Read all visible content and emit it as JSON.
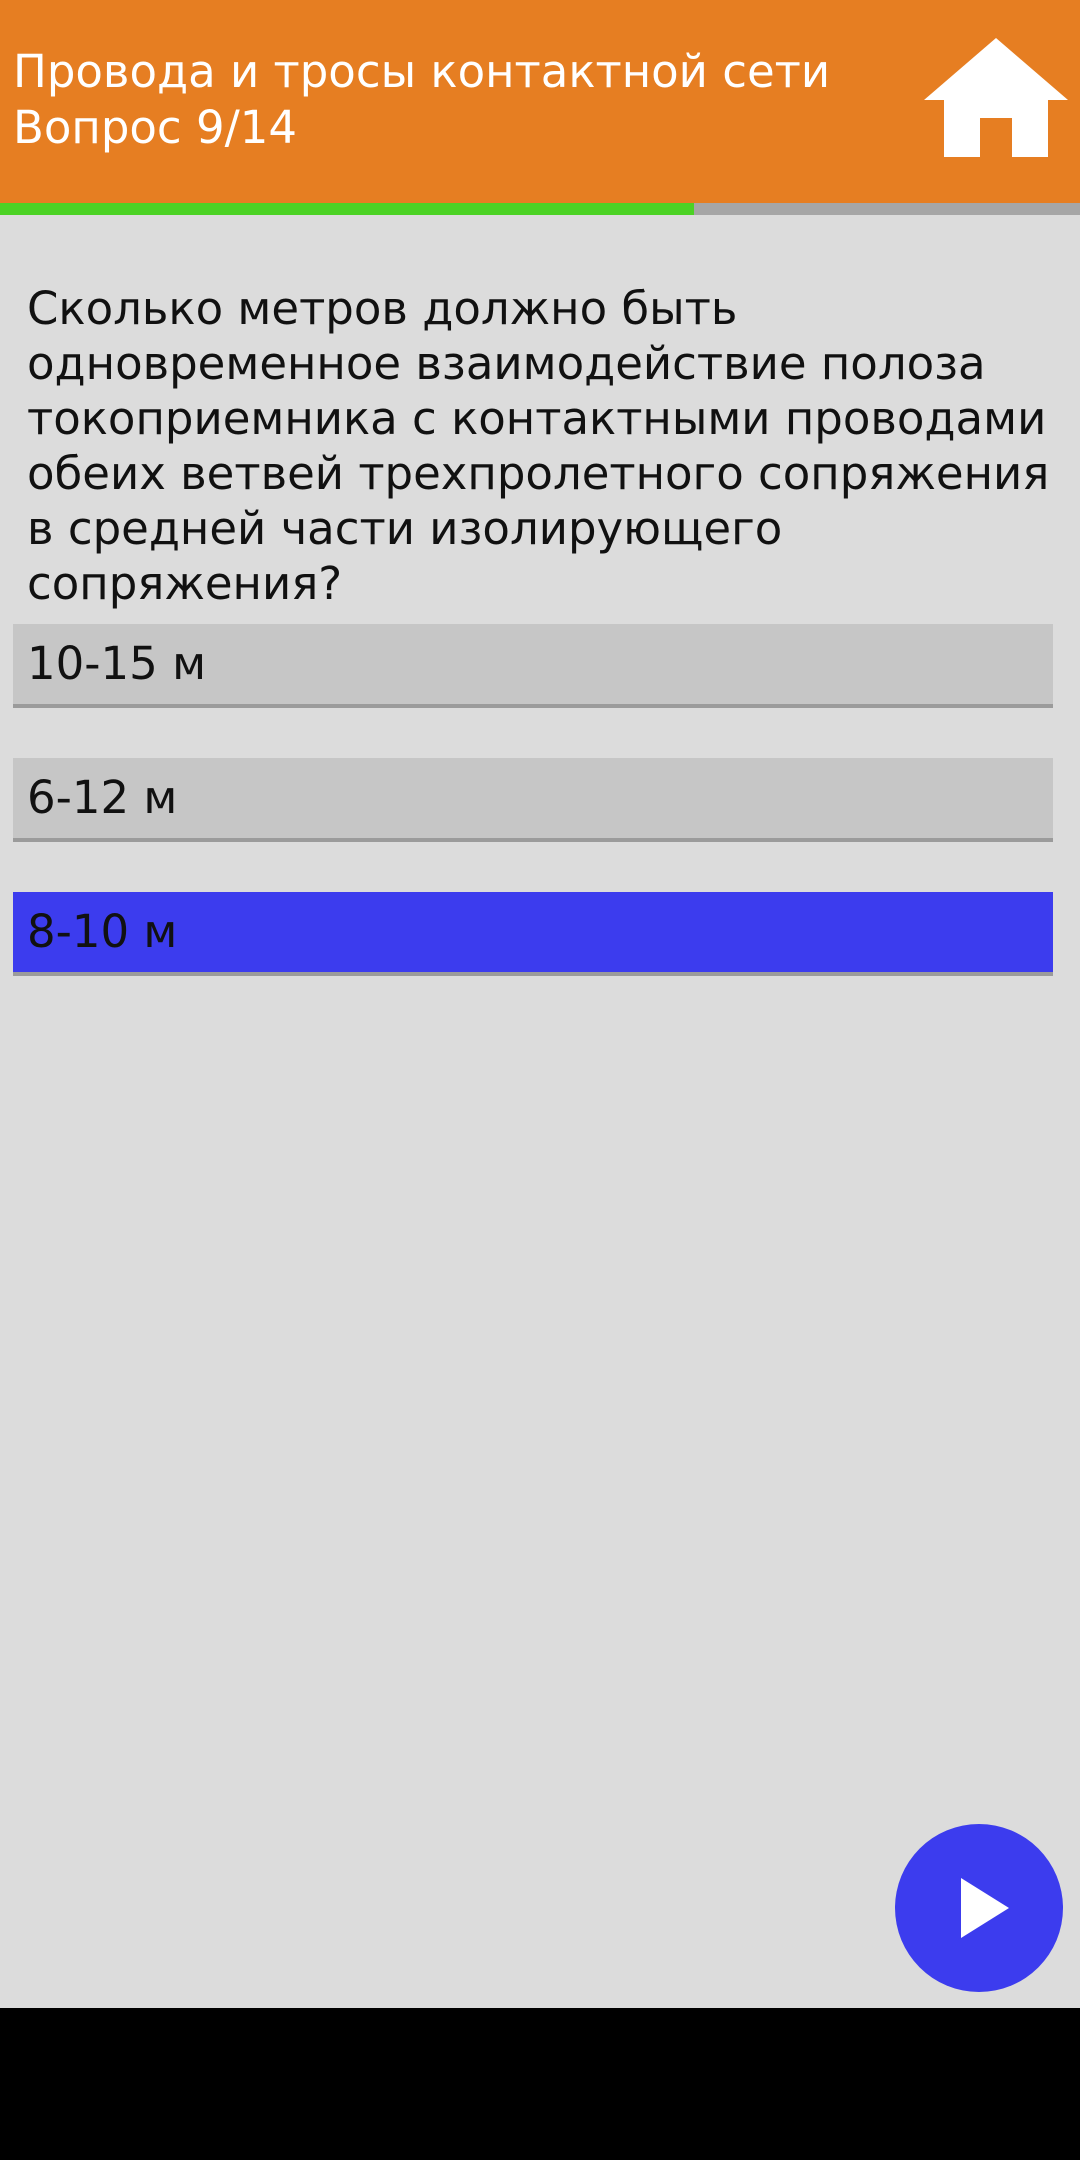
{
  "header": {
    "title": "Провода и тросы контактной сети",
    "subtitle": "Вопрос 9/14",
    "home_icon": "home-icon",
    "background_color": "#e67e22"
  },
  "progress": {
    "current": 9,
    "total": 14,
    "fill_color": "#4cd225",
    "track_color": "#a6a6a6"
  },
  "question": {
    "text": "Сколько метров должно быть одновременное взаимодействие полоза токоприемника с контактными проводами обеих ветвей трехпролетного сопряжения в средней части изолирующего сопряжения?"
  },
  "answers": [
    {
      "label": "10-15 м",
      "selected": false
    },
    {
      "label": "6-12 м",
      "selected": false
    },
    {
      "label": "8-10 м",
      "selected": true
    }
  ],
  "colors": {
    "selected_answer": "#3c3cee",
    "unselected_answer": "#c6c6c6",
    "background": "#dcdcdc"
  },
  "next_button": {
    "icon": "play-arrow-icon",
    "color": "#3c3cee"
  }
}
